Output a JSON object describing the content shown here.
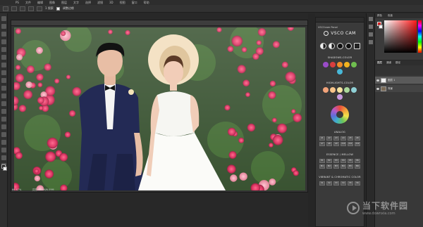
{
  "menubar": {
    "items": [
      "PS",
      "文件",
      "编辑",
      "图像",
      "图层",
      "文字",
      "选择",
      "滤镜",
      "3D",
      "视图",
      "窗口",
      "帮助"
    ]
  },
  "options": {
    "toggle_label": "1 搜索",
    "check_label": "调整边缘"
  },
  "document": {
    "tab_title": "e1100.jpg @ 66.7% (RGB/8#) ×",
    "zoom": "66.67%",
    "doc_size": "文档:6.59M/6.59M"
  },
  "vsco": {
    "panel_title": "VSCOcam Panel",
    "brand": "VSCO CAM",
    "shadows_title": "SHADOWS-COLOR",
    "shadows_colors": [
      "#9a4cc8",
      "#d93e3e",
      "#f08c2a",
      "#f2b21e",
      "#6fbe4f",
      "#48b8d8"
    ],
    "highlights_title": "HIGHLIGHTS-COLOR",
    "highlights_colors": [
      "#f2a37a",
      "#f7c48a",
      "#f4e2a0",
      "#a9d89b",
      "#8fd0d6",
      "#c79ae0"
    ],
    "analog_title": "ANALOG",
    "analog_buttons": [
      "A1",
      "A2",
      "A3",
      "A4",
      "A5",
      "A6",
      "A7",
      "A8",
      "A9",
      "A10",
      "A11",
      "A12"
    ],
    "essence_title": "ESSENCE / MELLOW",
    "essence_buttons": [
      "E1",
      "E2",
      "E3",
      "E4",
      "E5",
      "E6",
      "M1",
      "M2",
      "M3",
      "M4",
      "M5",
      "M6"
    ],
    "vibrant_title": "VIBRANT & CHROMATIC COLOR",
    "vibrant_buttons": [
      "V1",
      "V2",
      "V3",
      "V4",
      "V5",
      "V6"
    ]
  },
  "colorpanel": {
    "tabs": [
      "颜色",
      "色板"
    ],
    "accent": "#d81e1e"
  },
  "layers": {
    "tabs": [
      "图层",
      "通道",
      "路径"
    ],
    "rows": [
      {
        "name": "图层 1"
      },
      {
        "name": "背景"
      }
    ]
  },
  "watermark": {
    "text": "当下软件园",
    "url": "www.downxia.com"
  }
}
